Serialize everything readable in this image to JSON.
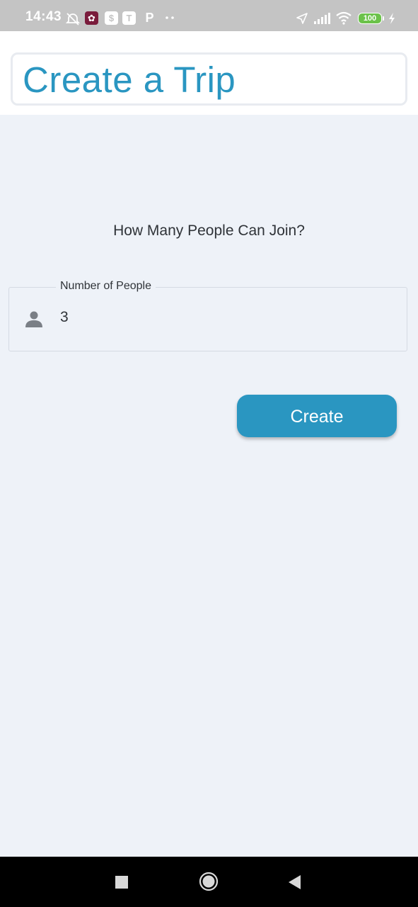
{
  "status_bar": {
    "time": "14:43",
    "battery_level": "100",
    "icons": [
      "alarm-off-icon",
      "app-icon",
      "dollar-app-icon",
      "teams-icon",
      "p-app-icon",
      "more-dots-icon",
      "location-icon",
      "cellular-signal-icon",
      "wifi-icon",
      "battery-icon",
      "charging-icon"
    ]
  },
  "header": {
    "title": "Create a Trip"
  },
  "main": {
    "question": "How Many People Can Join?",
    "people_field": {
      "label": "Number of People",
      "value": "3",
      "icon": "person-icon"
    },
    "create_button_label": "Create"
  },
  "nav_bar": {
    "buttons": [
      "recents-square-icon",
      "home-circle-icon",
      "back-triangle-icon"
    ]
  },
  "colors": {
    "accent": "#2a96c1",
    "background": "#eef2f8",
    "status_bar": "#c4c4c4",
    "text": "#2f3338"
  }
}
